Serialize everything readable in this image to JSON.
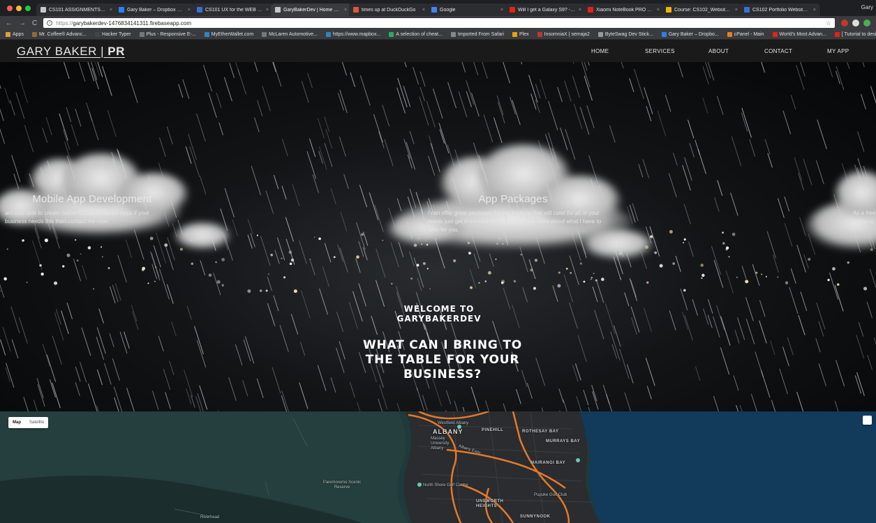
{
  "browser": {
    "tabs": [
      {
        "title": "CS101 ASSIGNMENTS-UX"
      },
      {
        "title": "Gary Baker – Dropbox Paper"
      },
      {
        "title": "CS101 UX for the WEB - Do"
      },
      {
        "title": "GaryBakerDev | Home Page",
        "active": true
      },
      {
        "title": "times up at DuckDuckGo"
      },
      {
        "title": "Google"
      },
      {
        "title": "Will I get a Galaxy S9? - Yo"
      },
      {
        "title": "Xiaomi NoteBook PRO HAC"
      },
      {
        "title": "Course: CS102_Website and"
      },
      {
        "title": "CS102 Portfolio Website Pr"
      }
    ],
    "profile": "Gary",
    "url": "https://garybakerdev-1476834141311.firebaseapp.com",
    "url_scheme": "https://",
    "url_host": "garybakerdev-1476834141311.firebaseapp.com",
    "bookmarks": [
      "Apps",
      "Mr. Coffee® Advanc...",
      "Hacker Typer",
      "Plus - Responsive E-...",
      "MyEtherWallet.com",
      "McLaren Automotive...",
      "https://www.mapbox...",
      "A selection of cheat...",
      "Imported From Safari",
      "Plex",
      "InsomniaX | semaja2",
      "ByteSwag Dev Stick...",
      "Gary Baker – Dropbo...",
      "cPanel - Main",
      "World's Most Advan...",
      "[ Tutorial to design ]..."
    ]
  },
  "site": {
    "brand_name": "GARY BAKER | ",
    "brand_suffix": "PR",
    "nav": [
      "HOME",
      "SERVICES",
      "ABOUT",
      "CONTACT",
      "MY APP"
    ]
  },
  "hero": {
    "services": [
      {
        "title": "Mobile App Development",
        "text": "am also able to create native iOS and Android Apps if your business needs this then contact me now!"
      },
      {
        "title": "App Packages",
        "text": "I can offer great packages for applications that will cater for all of your needs just get in contact with me to find out more about what I have to offer for you."
      },
      {
        "title": "",
        "text": "As a free online n"
      }
    ],
    "welcome": "WELCOME TO GARYBAKERDEV",
    "tagline": "WHAT CAN I BRING TO THE TABLE FOR YOUR BUSINESS?"
  },
  "map": {
    "map_type_options": [
      "Map",
      "Satellite"
    ],
    "selected_map_type": "Map",
    "labels": {
      "westfield": "Westfield Albany",
      "albany": "ALBANY",
      "massey": "Massey University Albany",
      "pinehill": "PINEHILL",
      "rothesay": "ROTHESAY BAY",
      "murrays": "MURRAYS BAY",
      "mairangi": "MAIRANGI BAY",
      "paremoremo": "Paremoremo Scenic Reserve",
      "golf": "North Shore Golf Centre",
      "pupuke": "Pupuke Golf Club",
      "unsworth": "UNSWORTH HEIGHTS",
      "sunnynook": "SUNNYNOOK",
      "riverhead": "Riverhead",
      "expressway": "Albany Expy"
    }
  }
}
